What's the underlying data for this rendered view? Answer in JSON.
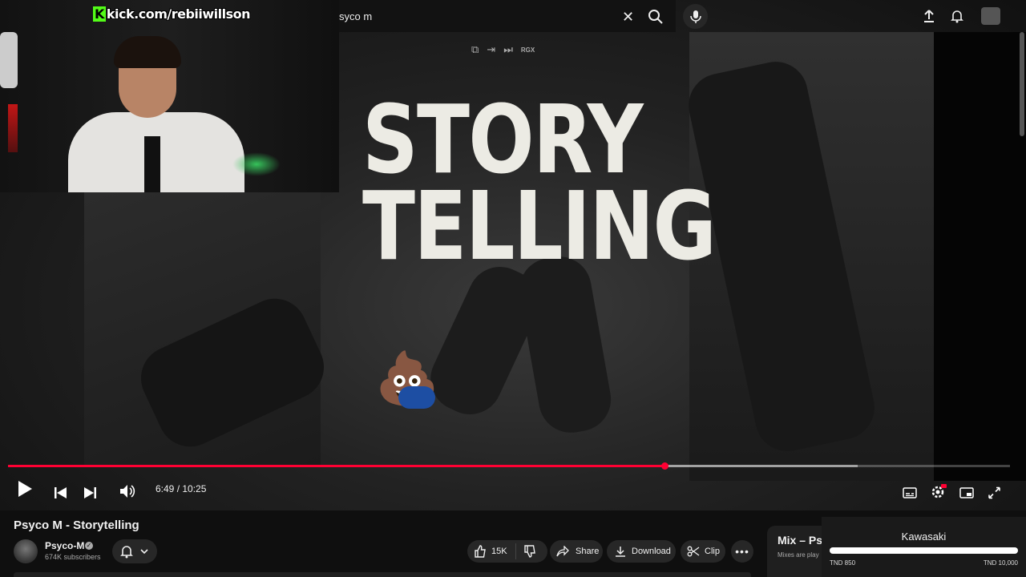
{
  "stream": {
    "watermark": "kick.com/rebiiwillson"
  },
  "search": {
    "query": "syco m"
  },
  "extension_bar": {
    "label": "RGX"
  },
  "artwork": {
    "line1": "STORY",
    "line2": "TELLING"
  },
  "player": {
    "current_time": "6:49",
    "duration": "10:25",
    "time_display": "6:49 / 10:25",
    "progress_fraction": 0.655,
    "buffered_fraction": 0.848,
    "accent_color": "#ff0033"
  },
  "video": {
    "title": "Psyco M - Storytelling",
    "channel": "Psyco-M",
    "subscribers": "674K subscribers",
    "likes": "15K",
    "share_label": "Share",
    "download_label": "Download",
    "clip_label": "Clip"
  },
  "mix": {
    "title": "Mix – Ps",
    "subtitle": "Mixes are play"
  },
  "overlay_widget": {
    "title": "Kawasaki",
    "min_label": "TND 850",
    "max_label": "TND 10,000",
    "fill_fraction": 1.0
  },
  "icons": [
    "clear-icon",
    "search-icon",
    "mic-icon",
    "upload-icon",
    "bell-icon",
    "profile-icon",
    "play-icon",
    "previous-icon",
    "next-icon",
    "volume-icon",
    "subtitles-icon",
    "settings-icon",
    "miniplayer-icon",
    "fullscreen-icon",
    "like-icon",
    "dislike-icon",
    "share-icon",
    "download-icon",
    "clip-icon",
    "more-icon"
  ]
}
